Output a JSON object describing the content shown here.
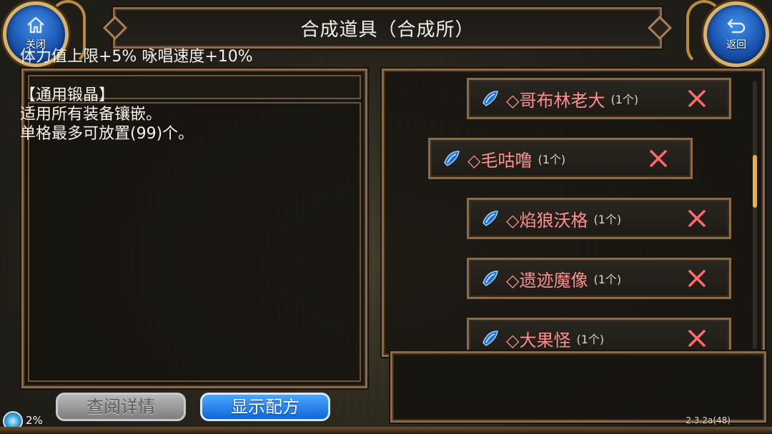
{
  "title": "合成道具（合成所）",
  "close_button": {
    "label": "关闭",
    "icon": "home-icon"
  },
  "back_button": {
    "label": "返回",
    "icon": "return-arrow-icon"
  },
  "description": {
    "line1": "体力值上限+5% 咏唱速度+10%",
    "line2": "【通用锻晶】",
    "line3": "适用所有装备镶嵌。",
    "line4": "单格最多可放置(99)个。"
  },
  "buttons": {
    "view_details": "查阅详情",
    "show_recipe": "显示配方"
  },
  "items": [
    {
      "name": "◇哥布林老大",
      "qty": "(1个)"
    },
    {
      "name": "◇毛咕噜",
      "qty": "(1个)"
    },
    {
      "name": "◇焰狼沃格",
      "qty": "(1个)"
    },
    {
      "name": "◇遗迹魔像",
      "qty": "(1个)"
    },
    {
      "name": "◇大果怪",
      "qty": "(1个)"
    }
  ],
  "status": {
    "percent": "2%",
    "progress": 0.02,
    "version": "2.3.2a(48)"
  },
  "colors": {
    "item_name": "#ff8f8f",
    "frame": "#8a6a48",
    "accent_blue": "#1a6fe0",
    "remove_x": "#ff6b6b",
    "scroll_thumb": "#e3b04a"
  }
}
